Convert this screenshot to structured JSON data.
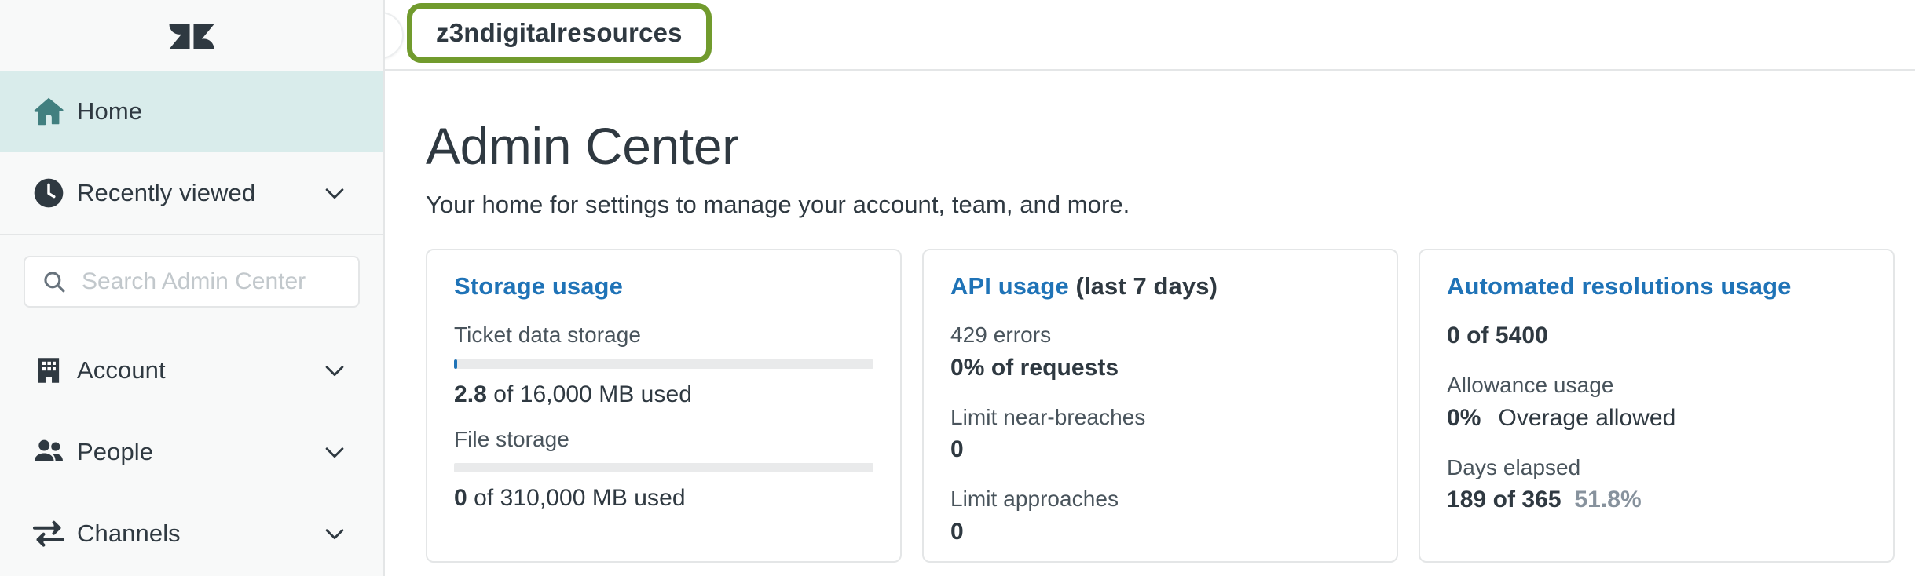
{
  "sidebar": {
    "logo_icon": "zendesk-logo",
    "items": [
      {
        "label": "Home",
        "icon": "home-icon",
        "active": true,
        "chevron": false
      },
      {
        "label": "Recently viewed",
        "icon": "clock-icon",
        "active": false,
        "chevron": true
      },
      {
        "label": "Account",
        "icon": "building-icon",
        "active": false,
        "chevron": true
      },
      {
        "label": "People",
        "icon": "people-icon",
        "active": false,
        "chevron": true
      },
      {
        "label": "Channels",
        "icon": "channels-icon",
        "active": false,
        "chevron": true
      }
    ],
    "search": {
      "placeholder": "Search Admin Center",
      "value": "",
      "icon": "search-icon"
    }
  },
  "topbar": {
    "collapse_icon": "chevron-left-icon",
    "account_name": "z3ndigitalresources",
    "highlight_color": "#719b2d"
  },
  "main": {
    "title": "Admin Center",
    "subtitle": "Your home for settings to manage your account, team, and more."
  },
  "cards": {
    "storage": {
      "title": "Storage usage",
      "ticket_label": "Ticket data storage",
      "ticket_progress_percent": 0.8,
      "ticket_value_bold": "2.8",
      "ticket_value_rest": " of 16,000 MB used",
      "file_label": "File storage",
      "file_progress_percent": 0,
      "file_value_bold": "0",
      "file_value_rest": " of 310,000 MB used"
    },
    "api": {
      "title": "API usage",
      "title_suffix": " (last 7 days)",
      "errors_label": "429 errors",
      "errors_value": "0% of requests",
      "near_breaches_label": "Limit near-breaches",
      "near_breaches_value": "0",
      "approaches_label": "Limit approaches",
      "approaches_value": "0"
    },
    "automated": {
      "title": "Automated resolutions usage",
      "total_value": "0 of 5400",
      "allowance_label": "Allowance usage",
      "allowance_value": "0%",
      "allowance_note": "Overage allowed",
      "days_label": "Days elapsed",
      "days_value": "189 of 365",
      "days_percent": "51.8%"
    }
  },
  "colors": {
    "link_blue": "#1f73b7",
    "sidebar_bg": "#f8f9f9",
    "active_row": "#d9eceb",
    "text_dark": "#2f3941",
    "muted": "#87929d",
    "border": "#e4e6e7"
  }
}
